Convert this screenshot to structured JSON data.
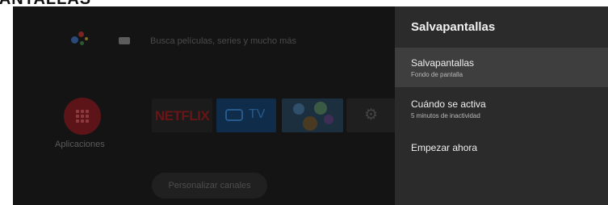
{
  "header": {
    "title_fragment": "PANTALLAS"
  },
  "home": {
    "search_hint": "Busca películas, series y mucho más",
    "apps_label": "Aplicaciones",
    "tiles": [
      {
        "name": "Netflix",
        "label": "NETFLIX"
      },
      {
        "name": "TV",
        "label": "TV"
      },
      {
        "name": "Media",
        "label": ""
      },
      {
        "name": "Settings",
        "label": ""
      }
    ],
    "customize_label": "Personalizar canales"
  },
  "panel": {
    "title": "Salvapantallas",
    "items": [
      {
        "primary": "Salvapantallas",
        "secondary": "Fondo de pantalla",
        "selected": true
      },
      {
        "primary": "Cuándo se activa",
        "secondary": "5 minutos de inactividad",
        "selected": false
      },
      {
        "primary": "Empezar ahora",
        "secondary": "",
        "selected": false
      }
    ]
  },
  "icons": {
    "assistant": "google-assistant-icon",
    "keyboard": "keyboard-icon",
    "apps": "apps-grid-icon",
    "tv": "tv-icon",
    "settings": "gear-icon"
  },
  "colors": {
    "panel_bg": "#2b2b2b",
    "selected_bg": "#3e3e3e",
    "netflix_red": "#6a1416",
    "tv_blue": "#0f2c4a"
  }
}
